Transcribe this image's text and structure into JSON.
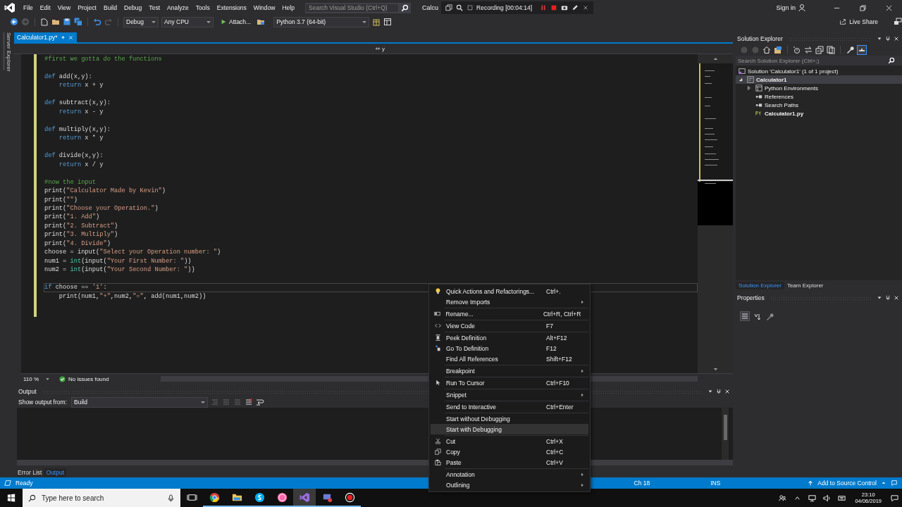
{
  "titlebar": {
    "menus": [
      "File",
      "Edit",
      "View",
      "Project",
      "Build",
      "Debug",
      "Test",
      "Analyze",
      "Tools",
      "Extensions",
      "Window",
      "Help"
    ],
    "search": {
      "placeholder": "Search Visual Studio (Ctrl+Q)"
    },
    "window_title": "Calcu",
    "recording": "Recording [00:04:14]",
    "sign_in": "Sign in"
  },
  "toolbar": {
    "configuration": "Debug",
    "platform": "Any CPU",
    "start": "Attach...",
    "environment": "Python 3.7 (64-bit)",
    "live_share": "Live Share"
  },
  "side_strip": {
    "label": "Server Explorer"
  },
  "editor": {
    "tab": {
      "title": "Calculator1.py*"
    },
    "nav": "y",
    "blocks": [
      [
        {
          "current": false,
          "tokens": [
            {
              "kind": "comment",
              "text": "#first we gotta do the functions"
            }
          ]
        }
      ],
      [
        {
          "current": false,
          "tokens": [
            {
              "kind": "keyword",
              "text": "def"
            },
            {
              "kind": "plain",
              "text": " add(x,y):"
            }
          ]
        },
        {
          "current": false,
          "tokens": [
            {
              "kind": "keyword",
              "text": "    return"
            },
            {
              "kind": "plain",
              "text": " x + y"
            }
          ]
        }
      ],
      [
        {
          "current": false,
          "tokens": [
            {
              "kind": "keyword",
              "text": "def"
            },
            {
              "kind": "plain",
              "text": " subtract(x,y):"
            }
          ]
        },
        {
          "current": false,
          "tokens": [
            {
              "kind": "keyword",
              "text": "    return"
            },
            {
              "kind": "plain",
              "text": " x - y"
            }
          ]
        }
      ],
      [
        {
          "current": false,
          "tokens": [
            {
              "kind": "keyword",
              "text": "def"
            },
            {
              "kind": "plain",
              "text": " multiply(x,y):"
            }
          ]
        },
        {
          "current": false,
          "tokens": [
            {
              "kind": "keyword",
              "text": "    return"
            },
            {
              "kind": "plain",
              "text": " x * y"
            }
          ]
        }
      ],
      [
        {
          "current": false,
          "tokens": [
            {
              "kind": "keyword",
              "text": "def"
            },
            {
              "kind": "plain",
              "text": " divide(x,y):"
            }
          ]
        },
        {
          "current": false,
          "tokens": [
            {
              "kind": "keyword",
              "text": "    return"
            },
            {
              "kind": "plain",
              "text": " x / y"
            }
          ]
        }
      ],
      [
        {
          "current": false,
          "tokens": [
            {
              "kind": "comment",
              "text": "#now the input"
            }
          ]
        },
        {
          "current": false,
          "tokens": [
            {
              "kind": "plain",
              "text": "print("
            },
            {
              "kind": "string",
              "text": "\"Calculator Made by Kevin\""
            },
            {
              "kind": "plain",
              "text": ")"
            }
          ]
        },
        {
          "current": false,
          "tokens": [
            {
              "kind": "plain",
              "text": "print("
            },
            {
              "kind": "string",
              "text": "\"\""
            },
            {
              "kind": "plain",
              "text": ")"
            }
          ]
        },
        {
          "current": false,
          "tokens": [
            {
              "kind": "plain",
              "text": "print("
            },
            {
              "kind": "string",
              "text": "\"Choose your Operation.\""
            },
            {
              "kind": "plain",
              "text": ")"
            }
          ]
        },
        {
          "current": false,
          "tokens": [
            {
              "kind": "plain",
              "text": "print("
            },
            {
              "kind": "string",
              "text": "\"1. Add\""
            },
            {
              "kind": "plain",
              "text": ")"
            }
          ]
        },
        {
          "current": false,
          "tokens": [
            {
              "kind": "plain",
              "text": "print("
            },
            {
              "kind": "string",
              "text": "\"2. Subtract\""
            },
            {
              "kind": "plain",
              "text": ")"
            }
          ]
        },
        {
          "current": false,
          "tokens": [
            {
              "kind": "plain",
              "text": "print("
            },
            {
              "kind": "string",
              "text": "\"3. Multiply\""
            },
            {
              "kind": "plain",
              "text": ")"
            }
          ]
        },
        {
          "current": false,
          "tokens": [
            {
              "kind": "plain",
              "text": "print("
            },
            {
              "kind": "string",
              "text": "\"4. Divide\""
            },
            {
              "kind": "plain",
              "text": ")"
            }
          ]
        },
        {
          "current": false,
          "tokens": [
            {
              "kind": "plain",
              "text": "choose = input("
            },
            {
              "kind": "string",
              "text": "\"Select your Operation number: \""
            },
            {
              "kind": "plain",
              "text": ")"
            }
          ]
        },
        {
          "current": false,
          "tokens": [
            {
              "kind": "plain",
              "text": "num1 = "
            },
            {
              "kind": "builtin",
              "text": "int"
            },
            {
              "kind": "plain",
              "text": "(input("
            },
            {
              "kind": "string",
              "text": "\"Your First Number: \""
            },
            {
              "kind": "plain",
              "text": "))"
            }
          ]
        },
        {
          "current": false,
          "tokens": [
            {
              "kind": "plain",
              "text": "num2 = "
            },
            {
              "kind": "builtin",
              "text": "int"
            },
            {
              "kind": "plain",
              "text": "(input("
            },
            {
              "kind": "string",
              "text": "\"Your Second Number: \""
            },
            {
              "kind": "plain",
              "text": "))"
            }
          ]
        }
      ],
      [
        {
          "current": true,
          "tokens": [
            {
              "kind": "keyword",
              "text": "if"
            },
            {
              "kind": "plain",
              "text": " choose == "
            },
            {
              "kind": "string",
              "text": "'1'"
            },
            {
              "kind": "plain",
              "text": ":"
            }
          ]
        },
        {
          "current": false,
          "tokens": [
            {
              "kind": "plain",
              "text": "    print(num1,"
            },
            {
              "kind": "string",
              "text": "\"+\""
            },
            {
              "kind": "plain",
              "text": ",num2,"
            },
            {
              "kind": "string",
              "text": "\"=\""
            },
            {
              "kind": "plain",
              "text": ", add(num1,num2))"
            }
          ]
        }
      ]
    ],
    "zoom": "110 %",
    "issues": "No issues found"
  },
  "output": {
    "title": "Output",
    "show_from_label": "Show output from:",
    "source": "Build",
    "tabs": [
      {
        "label": "Error List",
        "selected": false
      },
      {
        "label": "Output",
        "selected": true
      }
    ]
  },
  "context_menu": {
    "groups": [
      [
        {
          "label": "Quick Actions and Refactorings...",
          "shortcut": "Ctrl+.",
          "submenu": false,
          "selected": false
        },
        {
          "label": "Remove Imports",
          "submenu": true,
          "selected": false
        }
      ],
      [
        {
          "label": "Rename...",
          "shortcut": "Ctrl+R, Ctrl+R",
          "submenu": false,
          "selected": false
        }
      ],
      [
        {
          "label": "View Code",
          "shortcut": "F7",
          "submenu": false,
          "selected": false
        }
      ],
      [
        {
          "label": "Peek Definition",
          "shortcut": "Alt+F12",
          "submenu": false,
          "selected": false
        },
        {
          "label": "Go To Definition",
          "shortcut": "F12",
          "submenu": false,
          "selected": false
        },
        {
          "label": "Find All References",
          "shortcut": "Shift+F12",
          "submenu": false,
          "selected": false
        }
      ],
      [
        {
          "label": "Breakpoint",
          "submenu": true,
          "selected": false
        }
      ],
      [
        {
          "label": "Run To Cursor",
          "shortcut": "Ctrl+F10",
          "submenu": false,
          "selected": false
        }
      ],
      [
        {
          "label": "Snippet",
          "submenu": true,
          "selected": false
        }
      ],
      [
        {
          "label": "Send to Interactive",
          "shortcut": "Ctrl+Enter",
          "submenu": false,
          "selected": false
        }
      ],
      [
        {
          "label": "Start without Debugging",
          "submenu": false,
          "selected": false
        },
        {
          "label": "Start with Debugging",
          "submenu": false,
          "selected": true
        }
      ],
      [
        {
          "label": "Cut",
          "shortcut": "Ctrl+X",
          "submenu": false,
          "selected": false
        },
        {
          "label": "Copy",
          "shortcut": "Ctrl+C",
          "submenu": false,
          "selected": false
        },
        {
          "label": "Paste",
          "shortcut": "Ctrl+V",
          "submenu": false,
          "selected": false
        }
      ],
      [
        {
          "label": "Annotation",
          "submenu": true,
          "selected": false
        },
        {
          "label": "Outlining",
          "submenu": true,
          "selected": false
        }
      ]
    ]
  },
  "solution_explorer": {
    "title": "Solution Explorer",
    "search": {
      "placeholder": "Search Solution Explorer (Ctrl+;)"
    },
    "tree": [
      {
        "kind": "solution",
        "label": "Solution 'Calculator1' (1 of 1 project)",
        "selected": false,
        "startup": false,
        "children": [
          {
            "kind": "project",
            "label": "Calculator1",
            "expanded": true,
            "selected": true,
            "startup": true,
            "children": [
              {
                "kind": "environments",
                "label": "Python Environments",
                "expanded": false,
                "selected": false,
                "startup": false
              },
              {
                "kind": "group",
                "label": "References",
                "selected": false,
                "startup": false
              },
              {
                "kind": "group",
                "label": "Search Paths",
                "selected": false,
                "startup": false
              },
              {
                "kind": "file",
                "label": "Calculator1.py",
                "selected": false,
                "startup": true
              }
            ]
          }
        ]
      }
    ],
    "tabs": [
      {
        "label": "Solution Explorer",
        "selected": true
      },
      {
        "label": "Team Explorer",
        "selected": false
      }
    ]
  },
  "properties": {
    "title": "Properties"
  },
  "status_bar": {
    "state": "Ready",
    "column": "Ch 18",
    "mode": "INS",
    "source_control": "Add to Source Control"
  },
  "taskbar": {
    "search": {
      "placeholder": "Type here to search"
    },
    "apps": [
      {
        "kind": "taskview",
        "running": false,
        "active": false
      },
      {
        "kind": "browser",
        "running": true,
        "active": false
      },
      {
        "kind": "files",
        "running": true,
        "active": false
      },
      {
        "kind": "chat",
        "running": true,
        "active": false
      },
      {
        "kind": "game",
        "running": true,
        "active": false
      },
      {
        "kind": "ide",
        "running": true,
        "active": true
      },
      {
        "kind": "remote",
        "running": true,
        "active": false
      },
      {
        "kind": "recorder",
        "running": true,
        "active": false
      }
    ],
    "time": "23:10",
    "date": "04/06/2019"
  }
}
